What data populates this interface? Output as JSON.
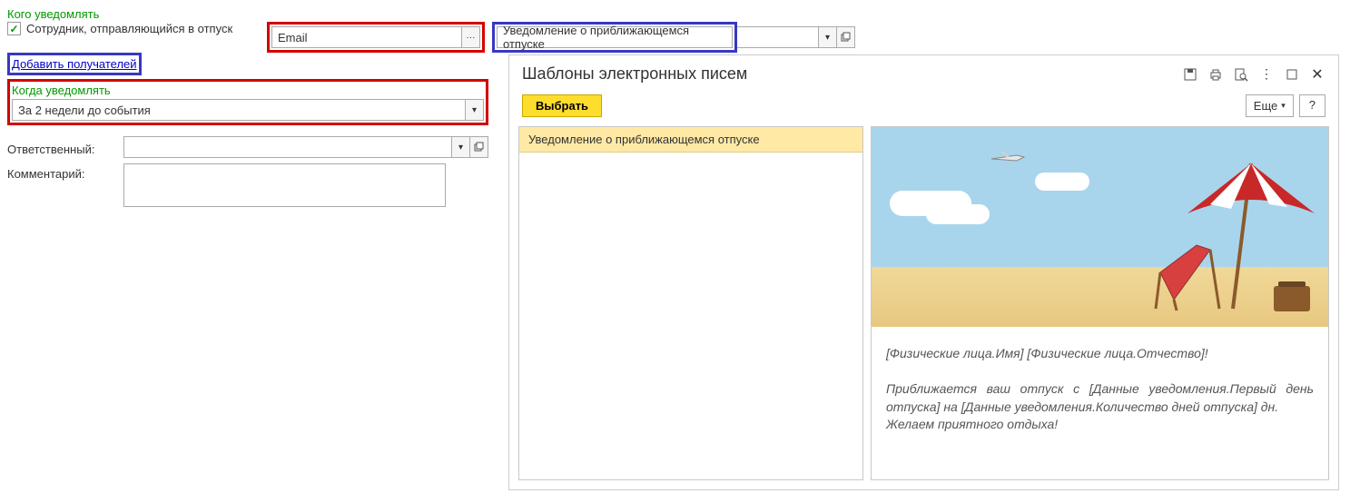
{
  "leftPane": {
    "whoLabel": "Кого уведомлять",
    "employeeCheckLabel": "Сотрудник, отправляющийся в отпуск",
    "emailValue": "Email",
    "templateValue": "Уведомление о приближающемся отпуске",
    "addRecipientsLink": "Добавить получателей",
    "whenLabel": "Когда уведомлять",
    "whenValue": "За 2 недели до события",
    "responsibleLabel": "Ответственный:",
    "commentLabel": "Комментарий:"
  },
  "dialog": {
    "title": "Шаблоны электронных писем",
    "selectBtn": "Выбрать",
    "moreBtn": "Еще",
    "helpBtn": "?",
    "listItem": "Уведомление о приближающемся отпуске",
    "preview": {
      "greeting": "[Физические лица.Имя] [Физические лица.Отчество]!",
      "body": "Приближается ваш отпуск с [Данные уведомления.Первый день отпуска] на [Данные уведомления.Количество дней отпуска] дн.",
      "wish": "Желаем приятного отдыха!"
    }
  }
}
